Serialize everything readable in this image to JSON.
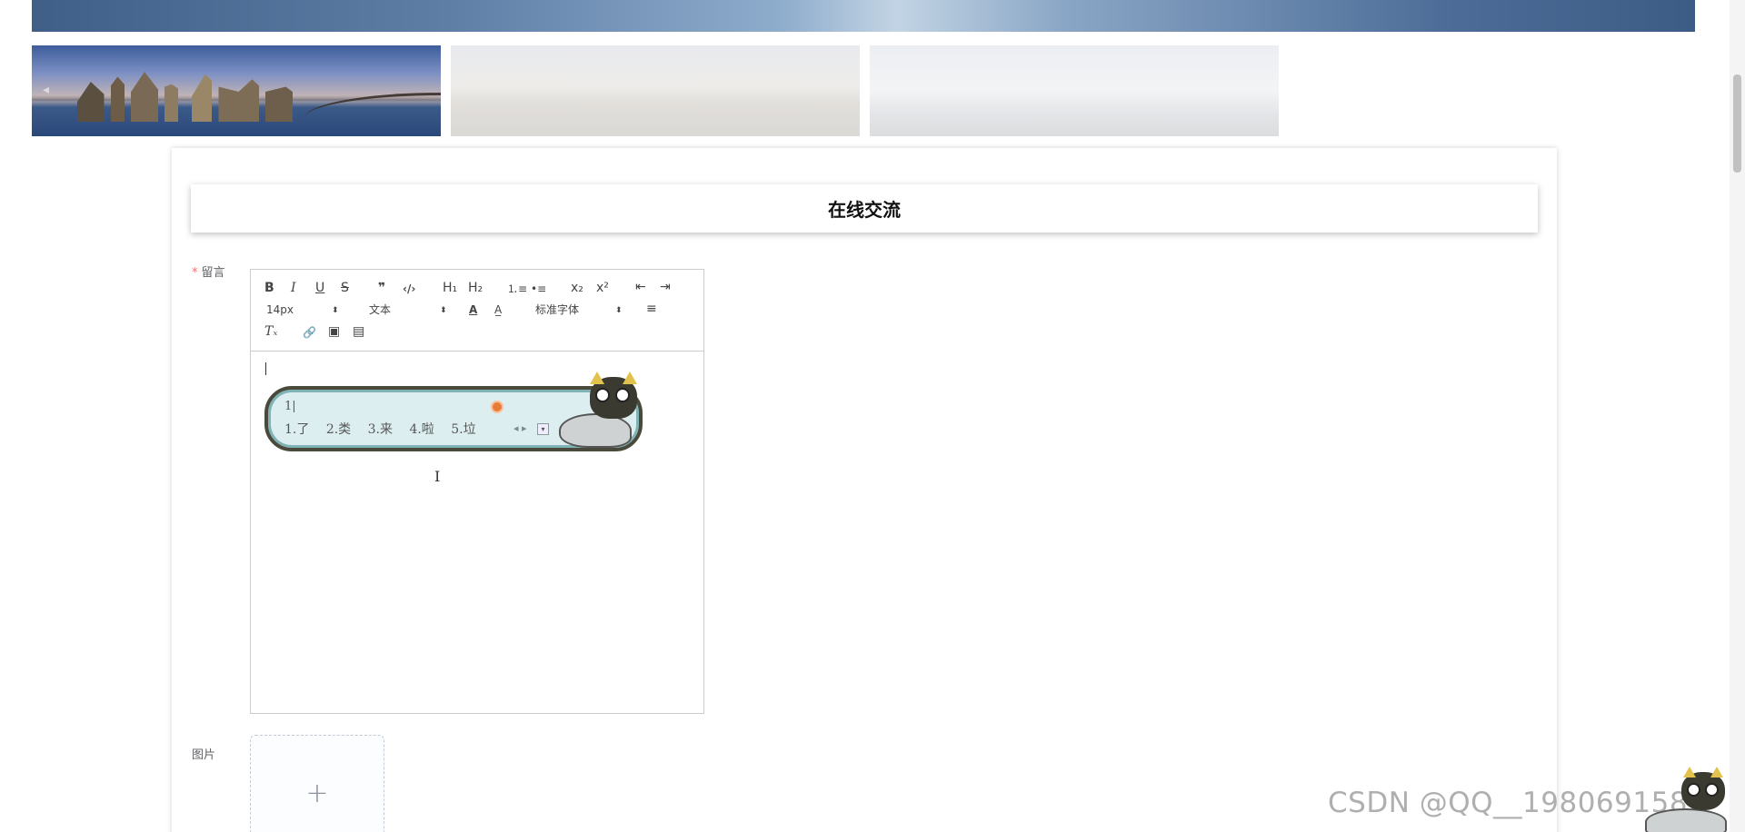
{
  "page_title": "在线交流",
  "carousel": {
    "prev_arrow": "◂"
  },
  "form": {
    "message_label": "留言",
    "required_mark": "*",
    "image_label": "图片"
  },
  "editor": {
    "toolbar": {
      "bold": "B",
      "italic": "I",
      "underline": "U",
      "strike": "S",
      "blockquote": "❞",
      "code": "‹/›",
      "h1": "H₁",
      "h2": "H₂",
      "ordered_list": "⒈≡",
      "bullet_list": "•≡",
      "subscript": "x₂",
      "superscript": "x²",
      "outdent": "⇤",
      "indent": "⇥",
      "size_value": "14px",
      "header_value": "文本",
      "font_color": "A",
      "background_color": "A̲",
      "font_value": "标准字体",
      "align": "≡",
      "clean": "Tₓ",
      "link": "🔗",
      "image": "▣",
      "video": "▤"
    },
    "select_caret": "⬍"
  },
  "ime": {
    "input_text": "1|",
    "candidates": [
      "1.了",
      "2.类",
      "3.来",
      "4.啦",
      "5.垃"
    ],
    "nav": "◂ ▸",
    "dropdown": "▾"
  },
  "upload": {
    "plus": "+"
  },
  "watermark": "CSDN @QQ__1980691589",
  "colors": {
    "required": "#f56c6c",
    "ime_background": "#dceef0",
    "ime_border": "#4a4a3c",
    "label": "#606266",
    "upload_border": "#c0ccda"
  },
  "icons": {
    "carousel_prev": "chevron-left-icon",
    "upload_add": "plus-icon",
    "link": "link-icon",
    "image": "image-icon",
    "video": "video-icon"
  }
}
